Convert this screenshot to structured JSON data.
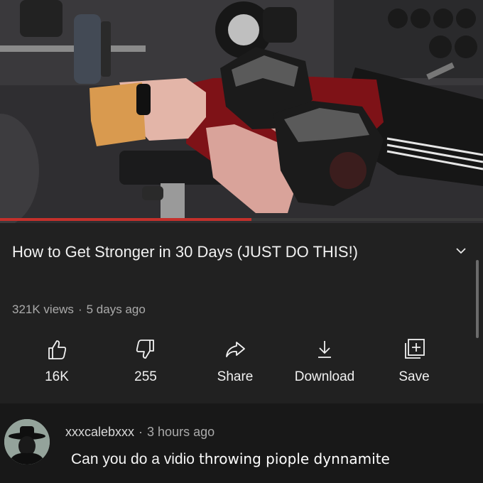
{
  "video": {
    "progress_fraction": 0.52,
    "accent_color": "#c4302b"
  },
  "info": {
    "title": "How to Get Stronger in 30 Days (JUST DO THIS!)",
    "views": "321K views",
    "age": "5 days ago",
    "expand_icon": "chevron-down-icon"
  },
  "actions": [
    {
      "icon": "thumbs-up-icon",
      "label": "16K"
    },
    {
      "icon": "thumbs-down-icon",
      "label": "255"
    },
    {
      "icon": "share-icon",
      "label": "Share"
    },
    {
      "icon": "download-icon",
      "label": "Download"
    },
    {
      "icon": "add-to-playlist-icon",
      "label": "Save"
    }
  ],
  "comment": {
    "author": "xxxcalebxxx",
    "time": "3 hours ago",
    "text_original": "Can you do a vidio",
    "text_edit": "throwing piople dynnamite"
  }
}
